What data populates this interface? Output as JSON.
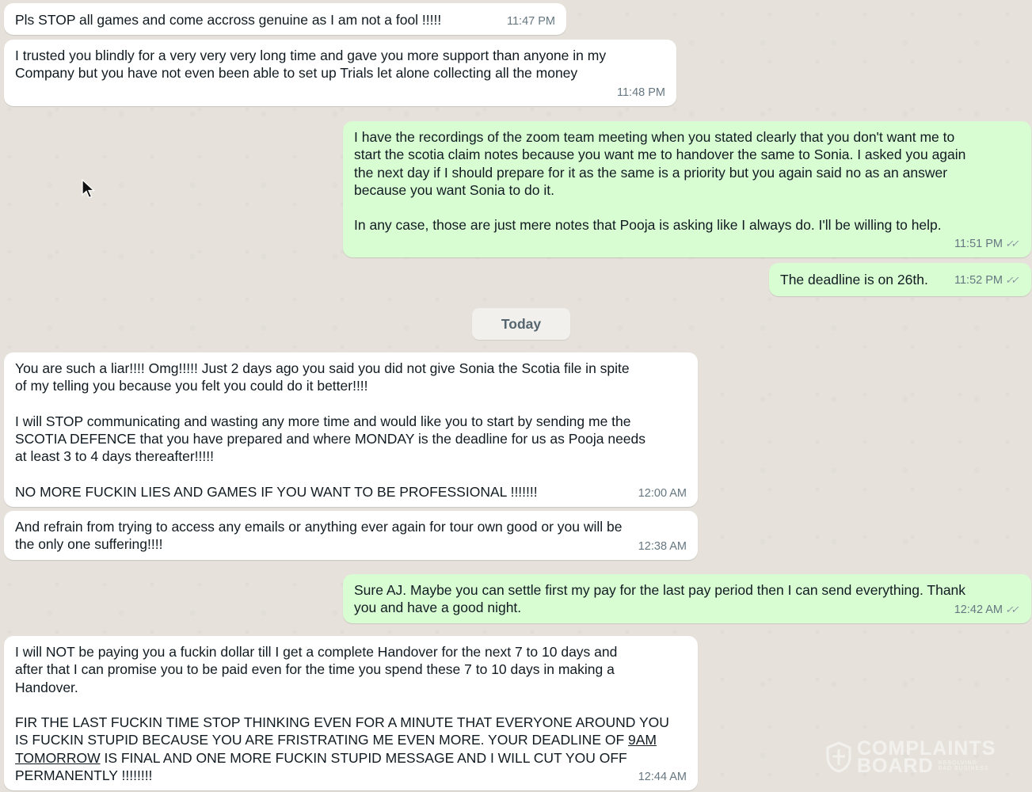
{
  "chat": {
    "date_separator": "Today",
    "messages": [
      {
        "text": "Pls STOP all games and come accross genuine as I am not a fool !!!!!",
        "time": "11:47 PM"
      },
      {
        "text": "I trusted you blindly for a very very very long time and gave you more support than anyone in my\nCompany but you have not even been able to set up Trials let alone collecting all the money",
        "time": "11:48 PM"
      },
      {
        "text": "I have the recordings of the zoom team meeting when you stated clearly that you don't want me to\nstart the scotia claim notes because you want me to handover the same to Sonia. I asked you again\nthe next day if I should prepare for it as the same is a priority but you again said no as an answer\nbecause you want Sonia to do it.\n\nIn any case, those are just mere notes that Pooja is asking like I always do. I'll be willing to help.",
        "time": "11:51 PM"
      },
      {
        "text": "The deadline is on 26th.",
        "time": "11:52 PM"
      },
      {
        "text": "You are such a liar!!!! Omg!!!!! Just 2 days ago you said you did not give Sonia the Scotia file in spite\nof my telling you because you felt you could do it better!!!!\n\nI will STOP communicating and wasting any more time and would like you to start by sending me the\nSCOTIA DEFENCE that you have prepared and where MONDAY is the deadline for us as Pooja needs\nat least 3 to 4 days thereafter!!!!!\n\nNO MORE FUCKIN LIES AND GAMES IF YOU WANT TO BE PROFESSIONAL !!!!!!!",
        "time": "12:00 AM"
      },
      {
        "text": "And refrain from trying to access any emails or anything ever again for tour own good or you will be\nthe only one suffering!!!!",
        "time": "12:38 AM"
      },
      {
        "text": "Sure AJ. Maybe you can settle first my pay for the last pay period then I can send everything. Thank\nyou and have a good night.",
        "time": "12:42 AM"
      },
      {
        "text_before": "I will NOT be paying you a fuckin dollar till I get a complete Handover for the next 7 to 10 days and\nafter that I can promise you to be paid even for the time you spend these 7 to 10 days in making a\nHandover.\n\nFIR THE LAST FUCKIN TIME STOP THINKING EVEN FOR A MINUTE THAT EVERYONE AROUND YOU\nIS FUCKIN STUPID BECAUSE YOU ARE FRISTRATING ME EVEN MORE. YOUR DEADLINE OF ",
        "underlined_1": "9AM",
        "underlined_2": "TOMORROW",
        "text_after": " IS FINAL AND ONE MORE FUCKIN STUPID MESSAGE AND I WILL CUT YOU OFF\nPERMANENTLY !!!!!!!!",
        "time": "12:44 AM"
      }
    ]
  },
  "read_receipt_icon": "double-check-icon",
  "watermark": {
    "line1": "COMPLAINTS",
    "line2": "BOARD",
    "tagline_1": "RESOLVING",
    "tagline_2": "BAD BUSINESS"
  },
  "colors": {
    "incoming": "#ffffff",
    "outgoing": "#d9fdd3",
    "background": "#e6e2db",
    "timestamp": "#667781"
  }
}
